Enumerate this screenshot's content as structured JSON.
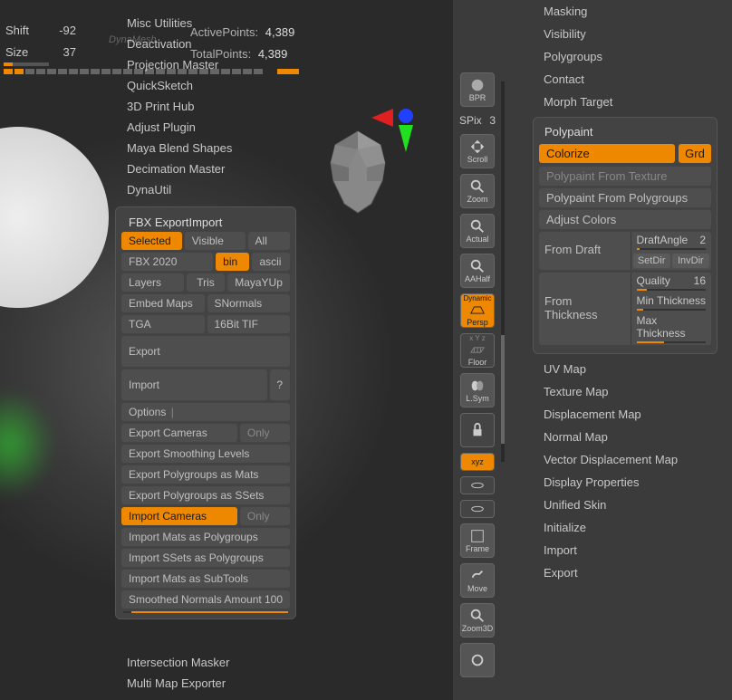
{
  "header": {
    "active_points_label": "ActivePoints:",
    "active_points_value": "4,389",
    "total_points_label": "TotalPoints:",
    "total_points_value": "4,389",
    "dyna_label": "DynaMesh",
    "shift_label": "Shift",
    "shift_value": "-92",
    "size_label": "Size",
    "size_value": "37"
  },
  "zplugin": {
    "items": [
      "Misc Utilities",
      "Deactivation",
      "Projection Master",
      "QuickSketch",
      "3D Print Hub",
      "Adjust Plugin",
      "Maya Blend Shapes",
      "Decimation Master",
      "DynaUtil"
    ],
    "fbx_title": "FBX ExportImport",
    "after": [
      "Intersection Masker",
      "Multi Map Exporter"
    ]
  },
  "fbx": {
    "selected": "Selected",
    "visible": "Visible",
    "all": "All",
    "version": "FBX 2020",
    "bin": "bin",
    "ascii": "ascii",
    "layers": "Layers",
    "tris": "Tris",
    "mayayup": "MayaYUp",
    "embed": "Embed Maps",
    "snormals": "SNormals",
    "tga": "TGA",
    "tif16": "16Bit TIF",
    "export": "Export",
    "import": "Import",
    "question": "?",
    "options": "Options",
    "export_cameras": "Export Cameras",
    "only": "Only",
    "export_smoothing": "Export Smoothing Levels",
    "export_pg_mats": "Export Polygroups as Mats",
    "export_pg_ssets": "Export Polygroups as SSets",
    "import_cameras": "Import Cameras",
    "import_mats_pg": "Import Mats as Polygroups",
    "import_ssets_pg": "Import SSets as Polygroups",
    "import_mats_sub": "Import Mats as SubTools",
    "smoothed_normals": "Smoothed Normals Amount",
    "smoothed_normals_val": "100"
  },
  "toolbar": {
    "bpr": "BPR",
    "spix_label": "SPix",
    "spix_val": "3",
    "scroll": "Scroll",
    "zoom": "Zoom",
    "actual": "Actual",
    "aahalf": "AAHalf",
    "persp": "Persp",
    "dynamic": "Dynamic",
    "floor": "Floor",
    "lsym": "L.Sym",
    "xyz": "xyz",
    "frame": "Frame",
    "move": "Move",
    "zoom3d": "Zoom3D"
  },
  "right": {
    "before": [
      "Masking",
      "Visibility",
      "Polygroups",
      "Contact",
      "Morph Target"
    ],
    "polypaint": {
      "title": "Polypaint",
      "colorize": "Colorize",
      "grd": "Grd",
      "from_texture": "Polypaint From Texture",
      "from_polygroups": "Polypaint From Polygroups",
      "adjust": "Adjust Colors",
      "from_draft": "From Draft",
      "draft_angle": "DraftAngle",
      "draft_angle_val": "2",
      "setdir": "SetDir",
      "invdir": "InvDir",
      "from_thickness": "From Thickness",
      "quality": "Quality",
      "quality_val": "16",
      "min_thick": "Min Thickness",
      "max_thick": "Max Thickness"
    },
    "after": [
      "UV Map",
      "Texture Map",
      "Displacement Map",
      "Normal Map",
      "Vector Displacement Map",
      "Display Properties",
      "Unified Skin",
      "Initialize",
      "Import",
      "Export"
    ]
  }
}
